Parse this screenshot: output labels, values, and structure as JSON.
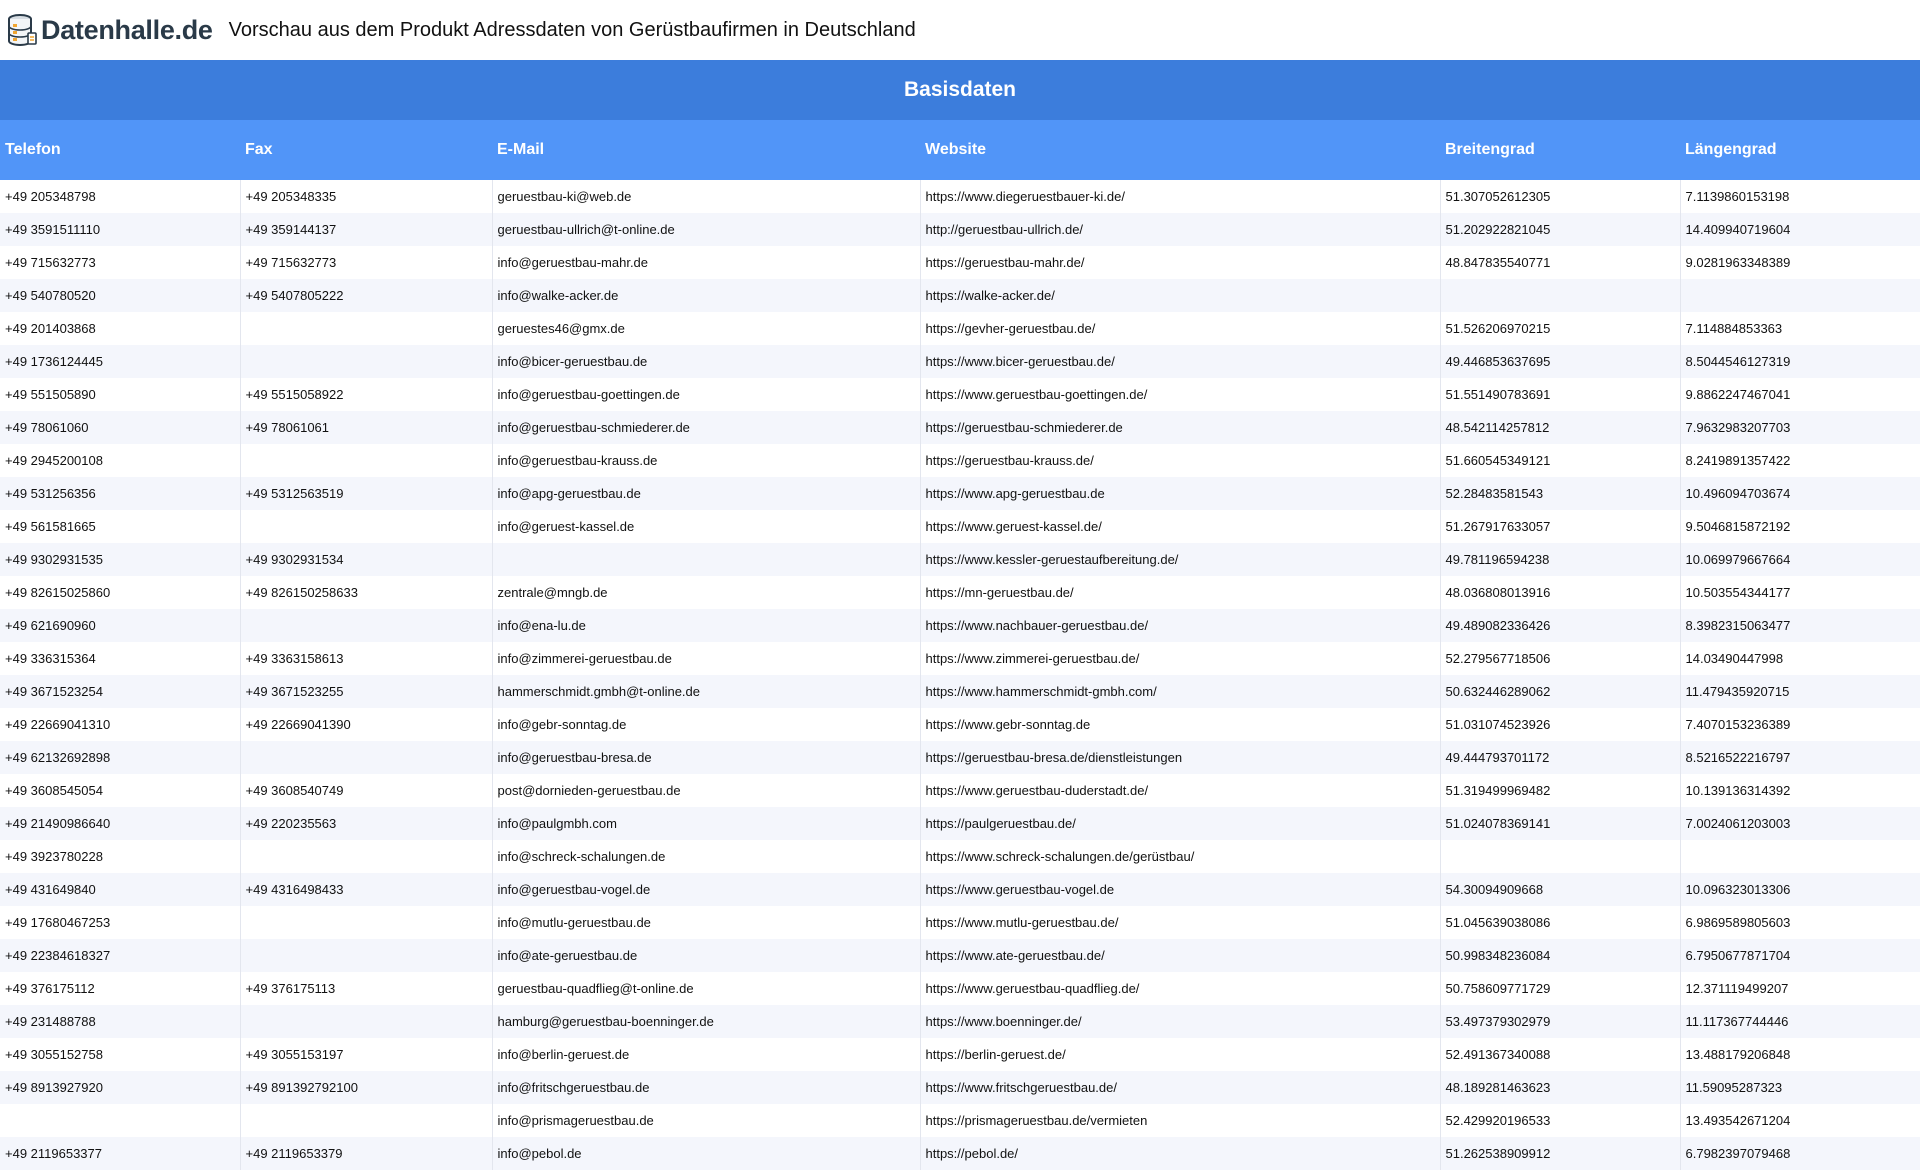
{
  "header": {
    "logo_text": "Datenhalle.de",
    "title": "Vorschau aus dem Produkt Adressdaten von Gerüstbaufirmen in Deutschland"
  },
  "section": {
    "title": "Basisdaten"
  },
  "colors": {
    "section_bg": "#3c7ddc",
    "header_bg": "#5195f8",
    "stripe": "#f4f6fc"
  },
  "table": {
    "columns": [
      "Telefon",
      "Fax",
      "E-Mail",
      "Website",
      "Breitengrad",
      "Längengrad"
    ],
    "rows": [
      [
        "+49 205348798",
        "+49 205348335",
        "geruestbau-ki@web.de",
        "https://www.diegeruestbauer-ki.de/",
        "51.307052612305",
        "7.1139860153198"
      ],
      [
        "+49 3591511110",
        "+49 359144137",
        "geruestbau-ullrich@t-online.de",
        "http://geruestbau-ullrich.de/",
        "51.202922821045",
        "14.409940719604"
      ],
      [
        "+49 715632773",
        "+49 715632773",
        "info@geruestbau-mahr.de",
        "https://geruestbau-mahr.de/",
        "48.847835540771",
        "9.0281963348389"
      ],
      [
        "+49 540780520",
        "+49 5407805222",
        "info@walke-acker.de",
        "https://walke-acker.de/",
        "",
        ""
      ],
      [
        "+49 201403868",
        "",
        "geruestes46@gmx.de",
        "https://gevher-geruestbau.de/",
        "51.526206970215",
        "7.114884853363"
      ],
      [
        "+49 1736124445",
        "",
        "info@bicer-geruestbau.de",
        "https://www.bicer-geruestbau.de/",
        "49.446853637695",
        "8.5044546127319"
      ],
      [
        "+49 551505890",
        "+49 5515058922",
        "info@geruestbau-goettingen.de",
        "https://www.geruestbau-goettingen.de/",
        "51.551490783691",
        "9.8862247467041"
      ],
      [
        "+49 78061060",
        "+49 78061061",
        "info@geruestbau-schmiederer.de",
        "https://geruestbau-schmiederer.de",
        "48.542114257812",
        "7.9632983207703"
      ],
      [
        "+49 2945200108",
        "",
        "info@geruestbau-krauss.de",
        "https://geruestbau-krauss.de/",
        "51.660545349121",
        "8.2419891357422"
      ],
      [
        "+49 531256356",
        "+49 5312563519",
        "info@apg-geruestbau.de",
        "https://www.apg-geruestbau.de",
        "52.28483581543",
        "10.496094703674"
      ],
      [
        "+49 561581665",
        "",
        "info@geruest-kassel.de",
        "https://www.geruest-kassel.de/",
        "51.267917633057",
        "9.5046815872192"
      ],
      [
        "+49 9302931535",
        "+49 9302931534",
        "",
        "https://www.kessler-geruestaufbereitung.de/",
        "49.781196594238",
        "10.069979667664"
      ],
      [
        "+49 82615025860",
        "+49 826150258633",
        "zentrale@mngb.de",
        "https://mn-geruestbau.de/",
        "48.036808013916",
        "10.503554344177"
      ],
      [
        "+49 621690960",
        "",
        "info@ena-lu.de",
        "https://www.nachbauer-geruestbau.de/",
        "49.489082336426",
        "8.3982315063477"
      ],
      [
        "+49 336315364",
        "+49 3363158613",
        "info@zimmerei-geruestbau.de",
        "https://www.zimmerei-geruestbau.de/",
        "52.279567718506",
        "14.03490447998"
      ],
      [
        "+49 3671523254",
        "+49 3671523255",
        "hammerschmidt.gmbh@t-online.de",
        "https://www.hammerschmidt-gmbh.com/",
        "50.632446289062",
        "11.479435920715"
      ],
      [
        "+49 22669041310",
        "+49 22669041390",
        "info@gebr-sonntag.de",
        "https://www.gebr-sonntag.de",
        "51.031074523926",
        "7.4070153236389"
      ],
      [
        "+49 62132692898",
        "",
        "info@geruestbau-bresa.de",
        "https://geruestbau-bresa.de/dienstleistungen",
        "49.444793701172",
        "8.5216522216797"
      ],
      [
        "+49 3608545054",
        "+49 3608540749",
        "post@dornieden-geruestbau.de",
        "https://www.geruestbau-duderstadt.de/",
        "51.319499969482",
        "10.139136314392"
      ],
      [
        "+49 21490986640",
        "+49 220235563",
        "info@paulgmbh.com",
        "https://paulgeruestbau.de/",
        "51.024078369141",
        "7.0024061203003"
      ],
      [
        "+49 3923780228",
        "",
        "info@schreck-schalungen.de",
        "https://www.schreck-schalungen.de/gerüstbau/",
        "",
        ""
      ],
      [
        "+49 431649840",
        "+49 4316498433",
        "info@geruestbau-vogel.de",
        "https://www.geruestbau-vogel.de",
        "54.30094909668",
        "10.096323013306"
      ],
      [
        "+49 17680467253",
        "",
        "info@mutlu-geruestbau.de",
        "https://www.mutlu-geruestbau.de/",
        "51.045639038086",
        "6.9869589805603"
      ],
      [
        "+49 22384618327",
        "",
        "info@ate-geruestbau.de",
        "https://www.ate-geruestbau.de/",
        "50.998348236084",
        "6.7950677871704"
      ],
      [
        "+49 376175112",
        "+49 376175113",
        "geruestbau-quadflieg@t-online.de",
        "https://www.geruestbau-quadflieg.de/",
        "50.758609771729",
        "12.371119499207"
      ],
      [
        "+49 231488788",
        "",
        "hamburg@geruestbau-boenninger.de",
        "https://www.boenninger.de/",
        "53.497379302979",
        "11.117367744446"
      ],
      [
        "+49 3055152758",
        "+49 3055153197",
        "info@berlin-geruest.de",
        "https://berlin-geruest.de/",
        "52.491367340088",
        "13.488179206848"
      ],
      [
        "+49 8913927920",
        "+49 891392792100",
        "info@fritschgeruestbau.de",
        "https://www.fritschgeruestbau.de/",
        "48.189281463623",
        "11.59095287323"
      ],
      [
        "",
        "",
        "info@prismageruestbau.de",
        "https://prismageruestbau.de/vermieten",
        "52.429920196533",
        "13.493542671204"
      ],
      [
        "+49 2119653377",
        "+49 2119653379",
        "info@pebol.de",
        "https://pebol.de/",
        "51.262538909912",
        "6.7982397079468"
      ]
    ]
  }
}
